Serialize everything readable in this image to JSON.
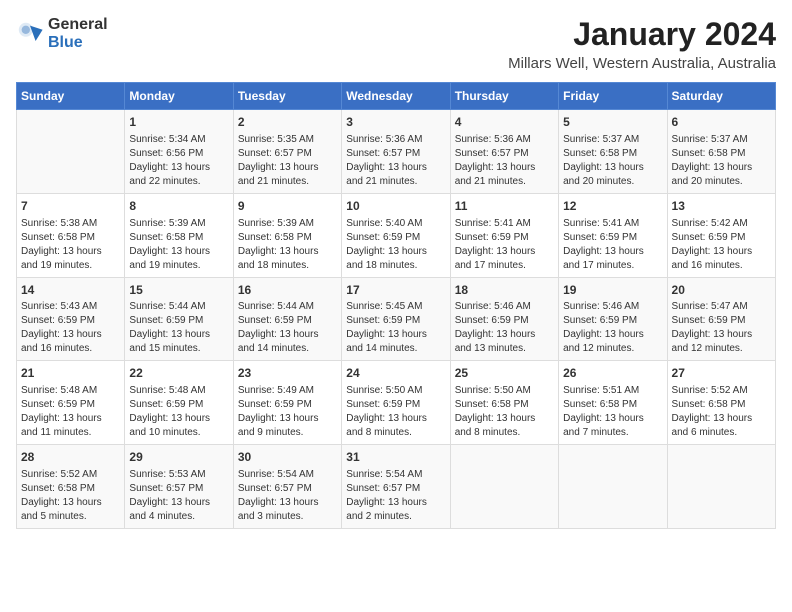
{
  "header": {
    "logo_general": "General",
    "logo_blue": "Blue",
    "main_title": "January 2024",
    "subtitle": "Millars Well, Western Australia, Australia"
  },
  "calendar": {
    "days_of_week": [
      "Sunday",
      "Monday",
      "Tuesday",
      "Wednesday",
      "Thursday",
      "Friday",
      "Saturday"
    ],
    "weeks": [
      [
        {
          "day": "",
          "info": ""
        },
        {
          "day": "1",
          "info": "Sunrise: 5:34 AM\nSunset: 6:56 PM\nDaylight: 13 hours\nand 22 minutes."
        },
        {
          "day": "2",
          "info": "Sunrise: 5:35 AM\nSunset: 6:57 PM\nDaylight: 13 hours\nand 21 minutes."
        },
        {
          "day": "3",
          "info": "Sunrise: 5:36 AM\nSunset: 6:57 PM\nDaylight: 13 hours\nand 21 minutes."
        },
        {
          "day": "4",
          "info": "Sunrise: 5:36 AM\nSunset: 6:57 PM\nDaylight: 13 hours\nand 21 minutes."
        },
        {
          "day": "5",
          "info": "Sunrise: 5:37 AM\nSunset: 6:58 PM\nDaylight: 13 hours\nand 20 minutes."
        },
        {
          "day": "6",
          "info": "Sunrise: 5:37 AM\nSunset: 6:58 PM\nDaylight: 13 hours\nand 20 minutes."
        }
      ],
      [
        {
          "day": "7",
          "info": "Sunrise: 5:38 AM\nSunset: 6:58 PM\nDaylight: 13 hours\nand 19 minutes."
        },
        {
          "day": "8",
          "info": "Sunrise: 5:39 AM\nSunset: 6:58 PM\nDaylight: 13 hours\nand 19 minutes."
        },
        {
          "day": "9",
          "info": "Sunrise: 5:39 AM\nSunset: 6:58 PM\nDaylight: 13 hours\nand 18 minutes."
        },
        {
          "day": "10",
          "info": "Sunrise: 5:40 AM\nSunset: 6:59 PM\nDaylight: 13 hours\nand 18 minutes."
        },
        {
          "day": "11",
          "info": "Sunrise: 5:41 AM\nSunset: 6:59 PM\nDaylight: 13 hours\nand 17 minutes."
        },
        {
          "day": "12",
          "info": "Sunrise: 5:41 AM\nSunset: 6:59 PM\nDaylight: 13 hours\nand 17 minutes."
        },
        {
          "day": "13",
          "info": "Sunrise: 5:42 AM\nSunset: 6:59 PM\nDaylight: 13 hours\nand 16 minutes."
        }
      ],
      [
        {
          "day": "14",
          "info": "Sunrise: 5:43 AM\nSunset: 6:59 PM\nDaylight: 13 hours\nand 16 minutes."
        },
        {
          "day": "15",
          "info": "Sunrise: 5:44 AM\nSunset: 6:59 PM\nDaylight: 13 hours\nand 15 minutes."
        },
        {
          "day": "16",
          "info": "Sunrise: 5:44 AM\nSunset: 6:59 PM\nDaylight: 13 hours\nand 14 minutes."
        },
        {
          "day": "17",
          "info": "Sunrise: 5:45 AM\nSunset: 6:59 PM\nDaylight: 13 hours\nand 14 minutes."
        },
        {
          "day": "18",
          "info": "Sunrise: 5:46 AM\nSunset: 6:59 PM\nDaylight: 13 hours\nand 13 minutes."
        },
        {
          "day": "19",
          "info": "Sunrise: 5:46 AM\nSunset: 6:59 PM\nDaylight: 13 hours\nand 12 minutes."
        },
        {
          "day": "20",
          "info": "Sunrise: 5:47 AM\nSunset: 6:59 PM\nDaylight: 13 hours\nand 12 minutes."
        }
      ],
      [
        {
          "day": "21",
          "info": "Sunrise: 5:48 AM\nSunset: 6:59 PM\nDaylight: 13 hours\nand 11 minutes."
        },
        {
          "day": "22",
          "info": "Sunrise: 5:48 AM\nSunset: 6:59 PM\nDaylight: 13 hours\nand 10 minutes."
        },
        {
          "day": "23",
          "info": "Sunrise: 5:49 AM\nSunset: 6:59 PM\nDaylight: 13 hours\nand 9 minutes."
        },
        {
          "day": "24",
          "info": "Sunrise: 5:50 AM\nSunset: 6:59 PM\nDaylight: 13 hours\nand 8 minutes."
        },
        {
          "day": "25",
          "info": "Sunrise: 5:50 AM\nSunset: 6:58 PM\nDaylight: 13 hours\nand 8 minutes."
        },
        {
          "day": "26",
          "info": "Sunrise: 5:51 AM\nSunset: 6:58 PM\nDaylight: 13 hours\nand 7 minutes."
        },
        {
          "day": "27",
          "info": "Sunrise: 5:52 AM\nSunset: 6:58 PM\nDaylight: 13 hours\nand 6 minutes."
        }
      ],
      [
        {
          "day": "28",
          "info": "Sunrise: 5:52 AM\nSunset: 6:58 PM\nDaylight: 13 hours\nand 5 minutes."
        },
        {
          "day": "29",
          "info": "Sunrise: 5:53 AM\nSunset: 6:57 PM\nDaylight: 13 hours\nand 4 minutes."
        },
        {
          "day": "30",
          "info": "Sunrise: 5:54 AM\nSunset: 6:57 PM\nDaylight: 13 hours\nand 3 minutes."
        },
        {
          "day": "31",
          "info": "Sunrise: 5:54 AM\nSunset: 6:57 PM\nDaylight: 13 hours\nand 2 minutes."
        },
        {
          "day": "",
          "info": ""
        },
        {
          "day": "",
          "info": ""
        },
        {
          "day": "",
          "info": ""
        }
      ]
    ]
  }
}
